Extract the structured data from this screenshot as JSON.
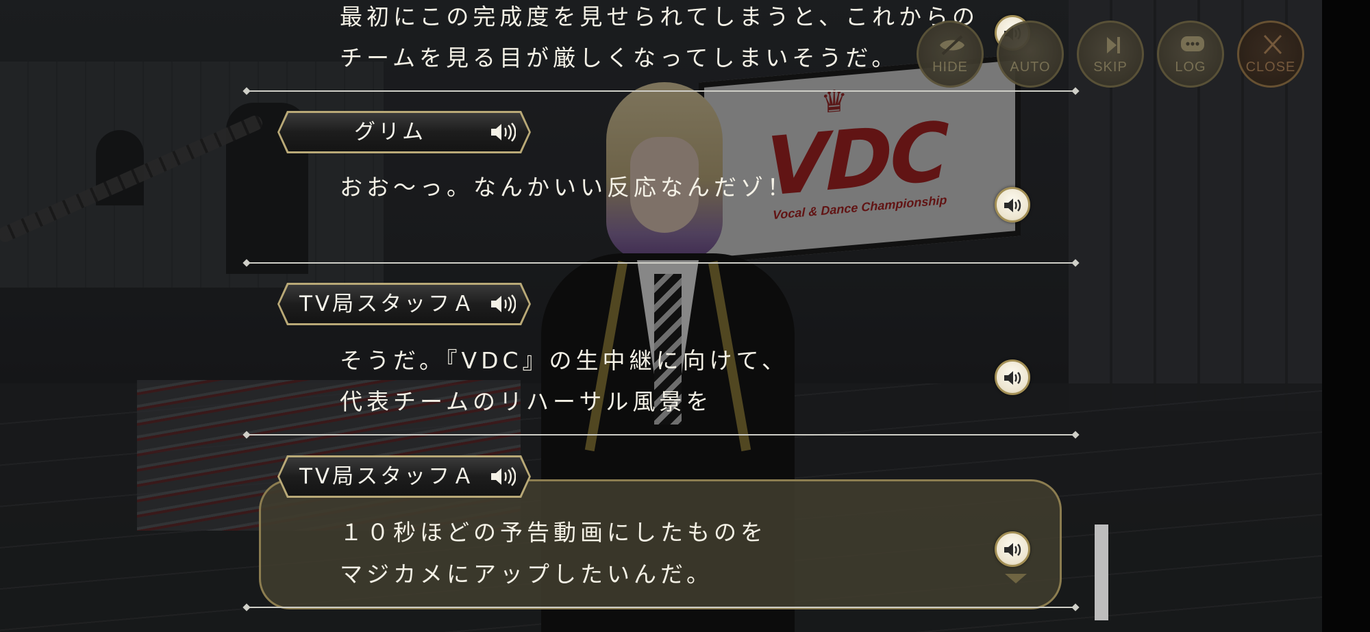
{
  "menu": {
    "hide_label": "HIDE",
    "auto_label": "AUTO",
    "skip_label": "SKIP",
    "log_label": "LOG",
    "close_label": "CLOSE"
  },
  "background": {
    "board_logo": "VDC",
    "board_subtitle": "Vocal & Dance Championship"
  },
  "log_entries": [
    {
      "speaker": "",
      "lines": [
        "最初にこの完成度を見せられてしまうと、これからの",
        "チームを見る目が厳しくなってしまいそうだ。"
      ]
    },
    {
      "speaker": "グリム",
      "lines": [
        "おお～っ。なんかいい反応なんだゾ！"
      ]
    },
    {
      "speaker": "TV局スタッフＡ",
      "lines": [
        "そうだ。『VDC』の生中継に向けて、",
        "代表チームのリハーサル風景を"
      ]
    },
    {
      "speaker": "TV局スタッフＡ",
      "lines": [
        "１０秒ほどの予告動画にしたものを",
        "マジカメにアップしたいんだ。"
      ]
    }
  ],
  "icons": {
    "voice": "speaker-icon",
    "hide": "eye-slash-icon",
    "auto": "auto-icon",
    "skip": "skip-icon",
    "log": "chat-bubble-icon",
    "close": "close-x-icon"
  },
  "colors": {
    "gold_trim": "#b9a977",
    "name_plate_bg": "#1d1d1d",
    "dialog_text": "#f4f1e6",
    "current_bubble": "#403c2e"
  }
}
